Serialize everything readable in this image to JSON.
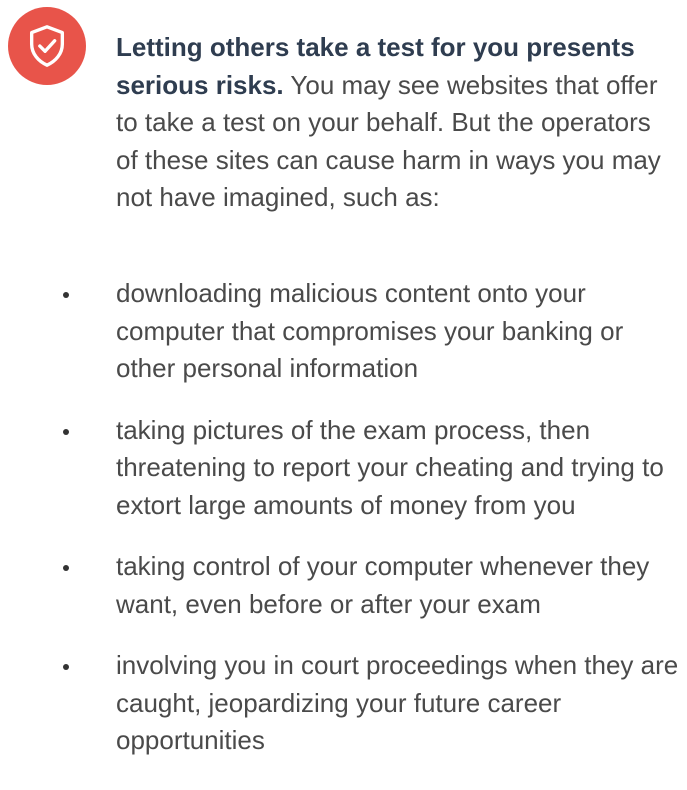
{
  "colors": {
    "badge": "#e8544a",
    "heading": "#2f3d50",
    "body": "#4a4a4a"
  },
  "badge_icon": "shield-check-icon",
  "intro": {
    "lead": "Letting others take a test for you presents serious risks.",
    "text": " You may see websites that offer to take a test on your behalf. But the operators of these sites can cause harm in ways you may not have imagined, such as:"
  },
  "bullets": [
    "downloading malicious content onto your computer that compromises your banking or other personal information",
    "taking pictures of the exam process, then threatening to report your cheating and trying to extort large amounts of money from you",
    "taking control of your computer whenever they want, even before or after your exam",
    "involving you in court proceedings when they are caught, jeopardizing your future career opportunities"
  ]
}
